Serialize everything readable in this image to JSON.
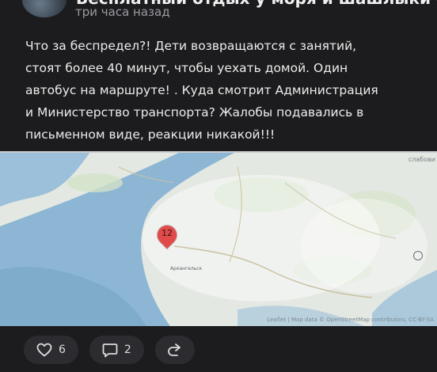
{
  "post": {
    "author_cut": "Бесплатный отдых у моря и шашлыки с Кузьмичом и Лулу",
    "timestamp": "три часа назад",
    "text_lines": [
      "Что за беспредел?! Дети возвращаются с занятий,",
      "стоят более 40 минут, чтобы уехать домой. Один",
      "автобус на маршруте! . Куда смотрит Администрация",
      "и Министерство транспорта? Жалобы подавались в",
      "письменном виде, реакции никакой!!!"
    ]
  },
  "map": {
    "pin_label": "12",
    "city_label": "Архангельск",
    "top_right_label": "слабови",
    "attribution": "Leaflet | Map data © OpenStreetMap contributors, CC-BY-SA",
    "colors": {
      "water": "#8fb8d6",
      "land": "#e6e9e4",
      "pin": "#e04b49"
    }
  },
  "actions": {
    "likes_count": "6",
    "comments_count": "2",
    "like_icon": "heart-icon",
    "comment_icon": "comment-icon",
    "share_icon": "share-icon"
  }
}
